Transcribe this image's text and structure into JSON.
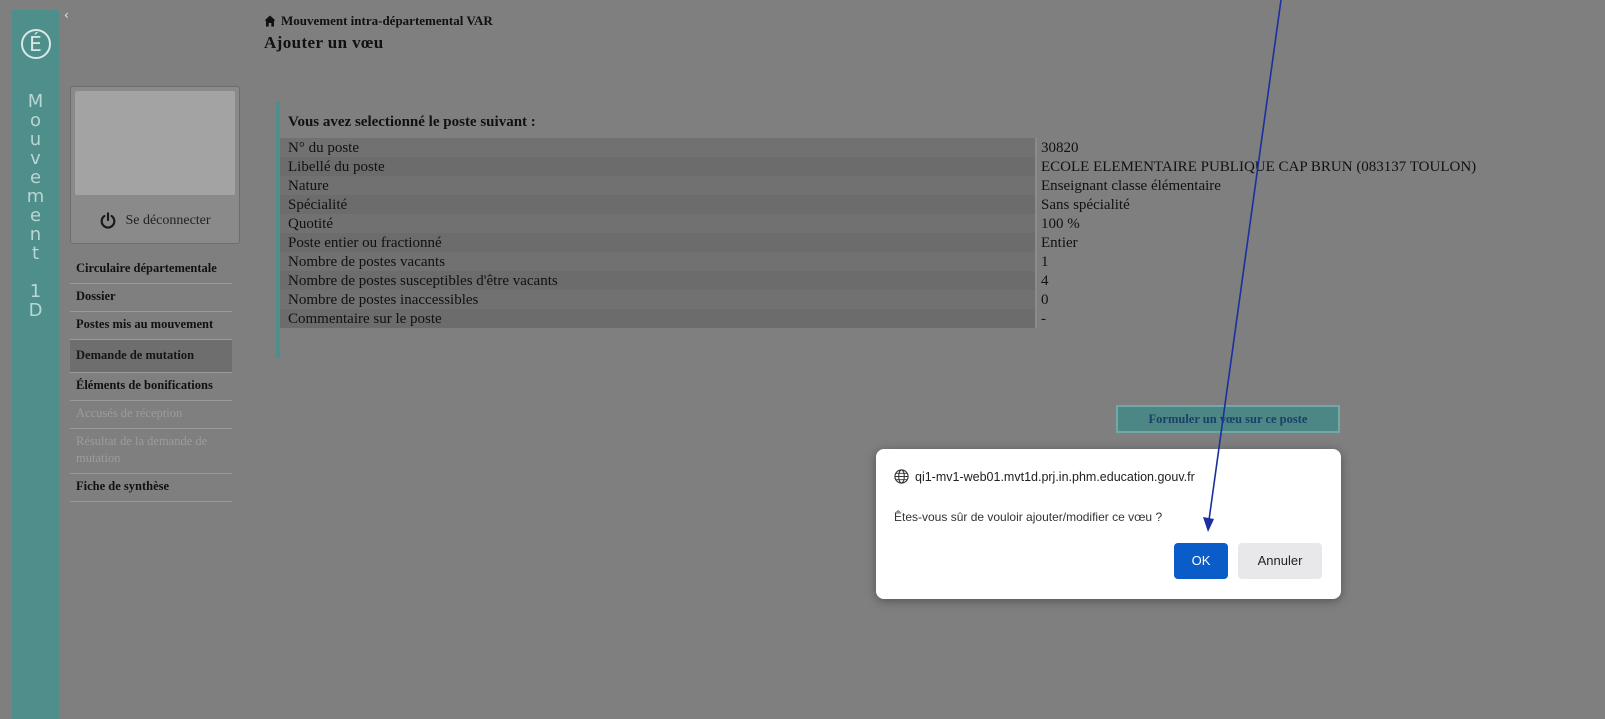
{
  "rail": {
    "logo_letter": "É",
    "letters": [
      "M",
      "o",
      "u",
      "v",
      "e",
      "m",
      "e",
      "n",
      "t",
      "",
      "1",
      "D"
    ]
  },
  "header": {
    "breadcrumb": "Mouvement intra-départemental VAR",
    "title": "Ajouter un vœu"
  },
  "sidebar": {
    "logout_label": "Se déconnecter",
    "items": [
      {
        "label": "Circulaire départementale",
        "state": "normal"
      },
      {
        "label": "Dossier",
        "state": "normal"
      },
      {
        "label": "Postes mis au mouvement",
        "state": "normal"
      },
      {
        "label": "Demande de mutation",
        "state": "active"
      },
      {
        "label": "Éléments de bonifications",
        "state": "normal"
      },
      {
        "label": "Accusés de réception",
        "state": "disabled"
      },
      {
        "label": "Résultat de la demande de mutation",
        "state": "disabled"
      },
      {
        "label": "Fiche de synthèse",
        "state": "normal"
      }
    ]
  },
  "detail": {
    "heading": "Vous avez selectionné le poste suivant :",
    "rows": [
      {
        "label": "N° du poste",
        "value": "30820"
      },
      {
        "label": "Libellé du poste",
        "value": "ECOLE ELEMENTAIRE PUBLIQUE CAP BRUN (083137 TOULON)"
      },
      {
        "label": "Nature",
        "value": "Enseignant classe élémentaire"
      },
      {
        "label": "Spécialité",
        "value": "Sans spécialité"
      },
      {
        "label": "Quotité",
        "value": "100 %"
      },
      {
        "label": "Poste entier ou fractionné",
        "value": "Entier"
      },
      {
        "label": "Nombre de postes vacants",
        "value": "1"
      },
      {
        "label": "Nombre de postes susceptibles d'être vacants",
        "value": "4"
      },
      {
        "label": "Nombre de postes inaccessibles",
        "value": "0"
      },
      {
        "label": "Commentaire sur le poste",
        "value": "-"
      }
    ]
  },
  "action": {
    "label": "Formuler un vœu sur ce poste"
  },
  "dialog": {
    "origin": "qi1-mv1-web01.mvt1d.prj.in.phm.education.gouv.fr",
    "message": "Êtes-vous sûr de vouloir ajouter/modifier ce vœu ?",
    "ok_label": "OK",
    "cancel_label": "Annuler"
  },
  "colors": {
    "accent_teal": "#4e8e8b",
    "ok_blue": "#0a5cc8",
    "arrow_blue": "#1a2fa0"
  }
}
